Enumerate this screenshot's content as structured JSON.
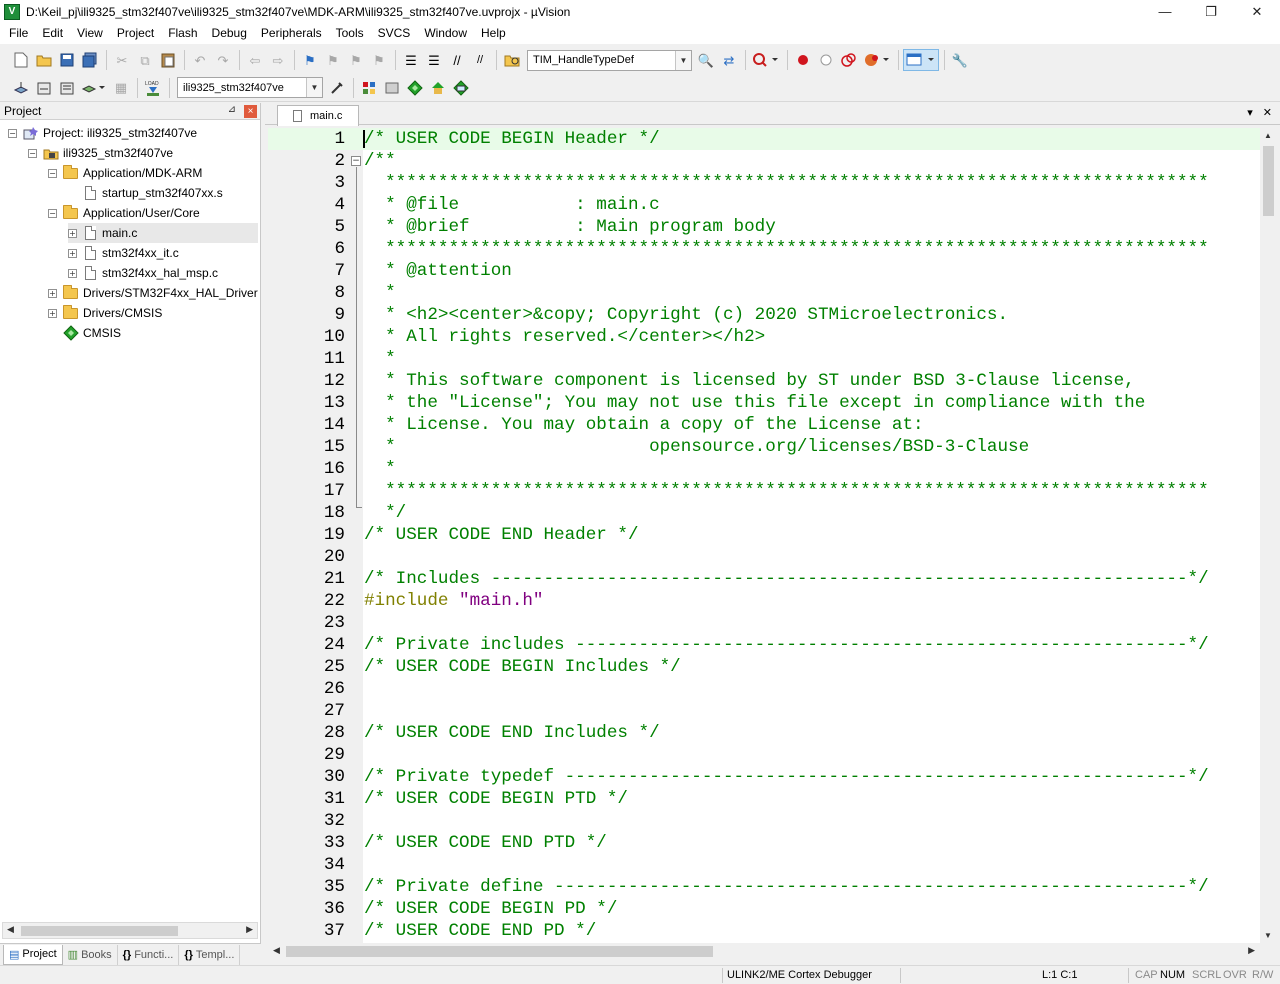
{
  "window": {
    "title": "D:\\Keil_pj\\ili9325_stm32f407ve\\ili9325_stm32f407ve\\MDK-ARM\\ili9325_stm32f407ve.uvprojx - µVision",
    "app_icon": "V",
    "minimize": "—",
    "maximize": "❐",
    "close": "✕"
  },
  "menu": [
    "File",
    "Edit",
    "View",
    "Project",
    "Flash",
    "Debug",
    "Peripherals",
    "Tools",
    "SVCS",
    "Window",
    "Help"
  ],
  "toolbar": {
    "find_combo_value": "TIM_HandleTypeDef",
    "target_combo_value": "ili9325_stm32f407ve"
  },
  "project_panel": {
    "title": "Project",
    "pin": "⊿",
    "close": "×",
    "tree": [
      {
        "label": "Project: ili9325_stm32f407ve",
        "level": 0,
        "expander": "−",
        "icon": "project-icon"
      },
      {
        "label": "ili9325_stm32f407ve",
        "level": 1,
        "expander": "−",
        "icon": "target-icon"
      },
      {
        "label": "Application/MDK-ARM",
        "level": 2,
        "expander": "−",
        "icon": "folder-icon"
      },
      {
        "label": "startup_stm32f407xx.s",
        "level": 3,
        "expander": "",
        "icon": "file-icon"
      },
      {
        "label": "Application/User/Core",
        "level": 2,
        "expander": "−",
        "icon": "folder-icon"
      },
      {
        "label": "main.c",
        "level": 3,
        "expander": "+",
        "icon": "file-icon",
        "selected": true
      },
      {
        "label": "stm32f4xx_it.c",
        "level": 3,
        "expander": "+",
        "icon": "file-icon"
      },
      {
        "label": "stm32f4xx_hal_msp.c",
        "level": 3,
        "expander": "+",
        "icon": "file-icon"
      },
      {
        "label": "Drivers/STM32F4xx_HAL_Driver",
        "level": 2,
        "expander": "+",
        "icon": "folder-icon"
      },
      {
        "label": "Drivers/CMSIS",
        "level": 2,
        "expander": "+",
        "icon": "folder-icon"
      },
      {
        "label": "CMSIS",
        "level": 2,
        "expander": "",
        "icon": "cmsis-icon"
      }
    ],
    "bottom_tabs": [
      {
        "label": "Project",
        "icon": "▤",
        "active": true
      },
      {
        "label": "Books",
        "icon": "▥",
        "active": false
      },
      {
        "label": "Functi...",
        "icon": "{}",
        "active": false
      },
      {
        "label": "Templ...",
        "icon": "{}",
        "active": false
      }
    ]
  },
  "editor": {
    "tab_label": "main.c",
    "tab_menu": "▾",
    "tab_close": "✕",
    "lines": [
      {
        "n": "1",
        "parts": [
          {
            "t": "/* USER CODE BEGIN Header */",
            "c": "cmt"
          }
        ]
      },
      {
        "n": "2",
        "parts": [
          {
            "t": "/**",
            "c": "cmt"
          }
        ]
      },
      {
        "n": "3",
        "parts": [
          {
            "t": "  ******************************************************************************",
            "c": "cmt"
          }
        ]
      },
      {
        "n": "4",
        "parts": [
          {
            "t": "  * @file           : main.c",
            "c": "cmt"
          }
        ]
      },
      {
        "n": "5",
        "parts": [
          {
            "t": "  * @brief          : Main program body",
            "c": "cmt"
          }
        ]
      },
      {
        "n": "6",
        "parts": [
          {
            "t": "  ******************************************************************************",
            "c": "cmt"
          }
        ]
      },
      {
        "n": "7",
        "parts": [
          {
            "t": "  * @attention",
            "c": "cmt"
          }
        ]
      },
      {
        "n": "8",
        "parts": [
          {
            "t": "  *",
            "c": "cmt"
          }
        ]
      },
      {
        "n": "9",
        "parts": [
          {
            "t": "  * <h2><center>&copy; Copyright (c) 2020 STMicroelectronics.",
            "c": "cmt"
          }
        ]
      },
      {
        "n": "10",
        "parts": [
          {
            "t": "  * All rights reserved.</center></h2>",
            "c": "cmt"
          }
        ]
      },
      {
        "n": "11",
        "parts": [
          {
            "t": "  *",
            "c": "cmt"
          }
        ]
      },
      {
        "n": "12",
        "parts": [
          {
            "t": "  * This software component is licensed by ST under BSD 3-Clause license,",
            "c": "cmt"
          }
        ]
      },
      {
        "n": "13",
        "parts": [
          {
            "t": "  * the \"License\"; You may not use this file except in compliance with the",
            "c": "cmt"
          }
        ]
      },
      {
        "n": "14",
        "parts": [
          {
            "t": "  * License. You may obtain a copy of the License at:",
            "c": "cmt"
          }
        ]
      },
      {
        "n": "15",
        "parts": [
          {
            "t": "  *                        opensource.org/licenses/BSD-3-Clause",
            "c": "cmt"
          }
        ]
      },
      {
        "n": "16",
        "parts": [
          {
            "t": "  *",
            "c": "cmt"
          }
        ]
      },
      {
        "n": "17",
        "parts": [
          {
            "t": "  ******************************************************************************",
            "c": "cmt"
          }
        ]
      },
      {
        "n": "18",
        "parts": [
          {
            "t": "  */",
            "c": "cmt"
          }
        ]
      },
      {
        "n": "19",
        "parts": [
          {
            "t": "/* USER CODE END Header */",
            "c": "cmt"
          }
        ]
      },
      {
        "n": "20",
        "parts": []
      },
      {
        "n": "21",
        "parts": [
          {
            "t": "/* Includes ------------------------------------------------------------------*/",
            "c": "cmt"
          }
        ]
      },
      {
        "n": "22",
        "parts": [
          {
            "t": "#include ",
            "c": "pre"
          },
          {
            "t": "\"main.h\"",
            "c": "str"
          }
        ]
      },
      {
        "n": "23",
        "parts": []
      },
      {
        "n": "24",
        "parts": [
          {
            "t": "/* Private includes ----------------------------------------------------------*/",
            "c": "cmt"
          }
        ]
      },
      {
        "n": "25",
        "parts": [
          {
            "t": "/* USER CODE BEGIN Includes */",
            "c": "cmt"
          }
        ]
      },
      {
        "n": "26",
        "parts": []
      },
      {
        "n": "27",
        "parts": []
      },
      {
        "n": "28",
        "parts": [
          {
            "t": "/* USER CODE END Includes */",
            "c": "cmt"
          }
        ]
      },
      {
        "n": "29",
        "parts": []
      },
      {
        "n": "30",
        "parts": [
          {
            "t": "/* Private typedef -----------------------------------------------------------*/",
            "c": "cmt"
          }
        ]
      },
      {
        "n": "31",
        "parts": [
          {
            "t": "/* USER CODE BEGIN PTD */",
            "c": "cmt"
          }
        ]
      },
      {
        "n": "32",
        "parts": []
      },
      {
        "n": "33",
        "parts": [
          {
            "t": "/* USER CODE END PTD */",
            "c": "cmt"
          }
        ]
      },
      {
        "n": "34",
        "parts": []
      },
      {
        "n": "35",
        "parts": [
          {
            "t": "/* Private define ------------------------------------------------------------*/",
            "c": "cmt"
          }
        ]
      },
      {
        "n": "36",
        "parts": [
          {
            "t": "/* USER CODE BEGIN PD */",
            "c": "cmt"
          }
        ]
      },
      {
        "n": "37",
        "parts": [
          {
            "t": "/* USER CODE END PD */",
            "c": "cmt"
          }
        ]
      }
    ]
  },
  "status_bar": {
    "debugger": "ULINK2/ME Cortex Debugger",
    "position": "L:1 C:1",
    "cap": "CAP",
    "num": "NUM",
    "scrl": "SCRL",
    "ovr": "OVR",
    "rw": "R/W"
  },
  "colors": {
    "comment": "#008000",
    "preprocessor": "#808000",
    "string": "#800080",
    "current_line": "#e8fbe8"
  }
}
